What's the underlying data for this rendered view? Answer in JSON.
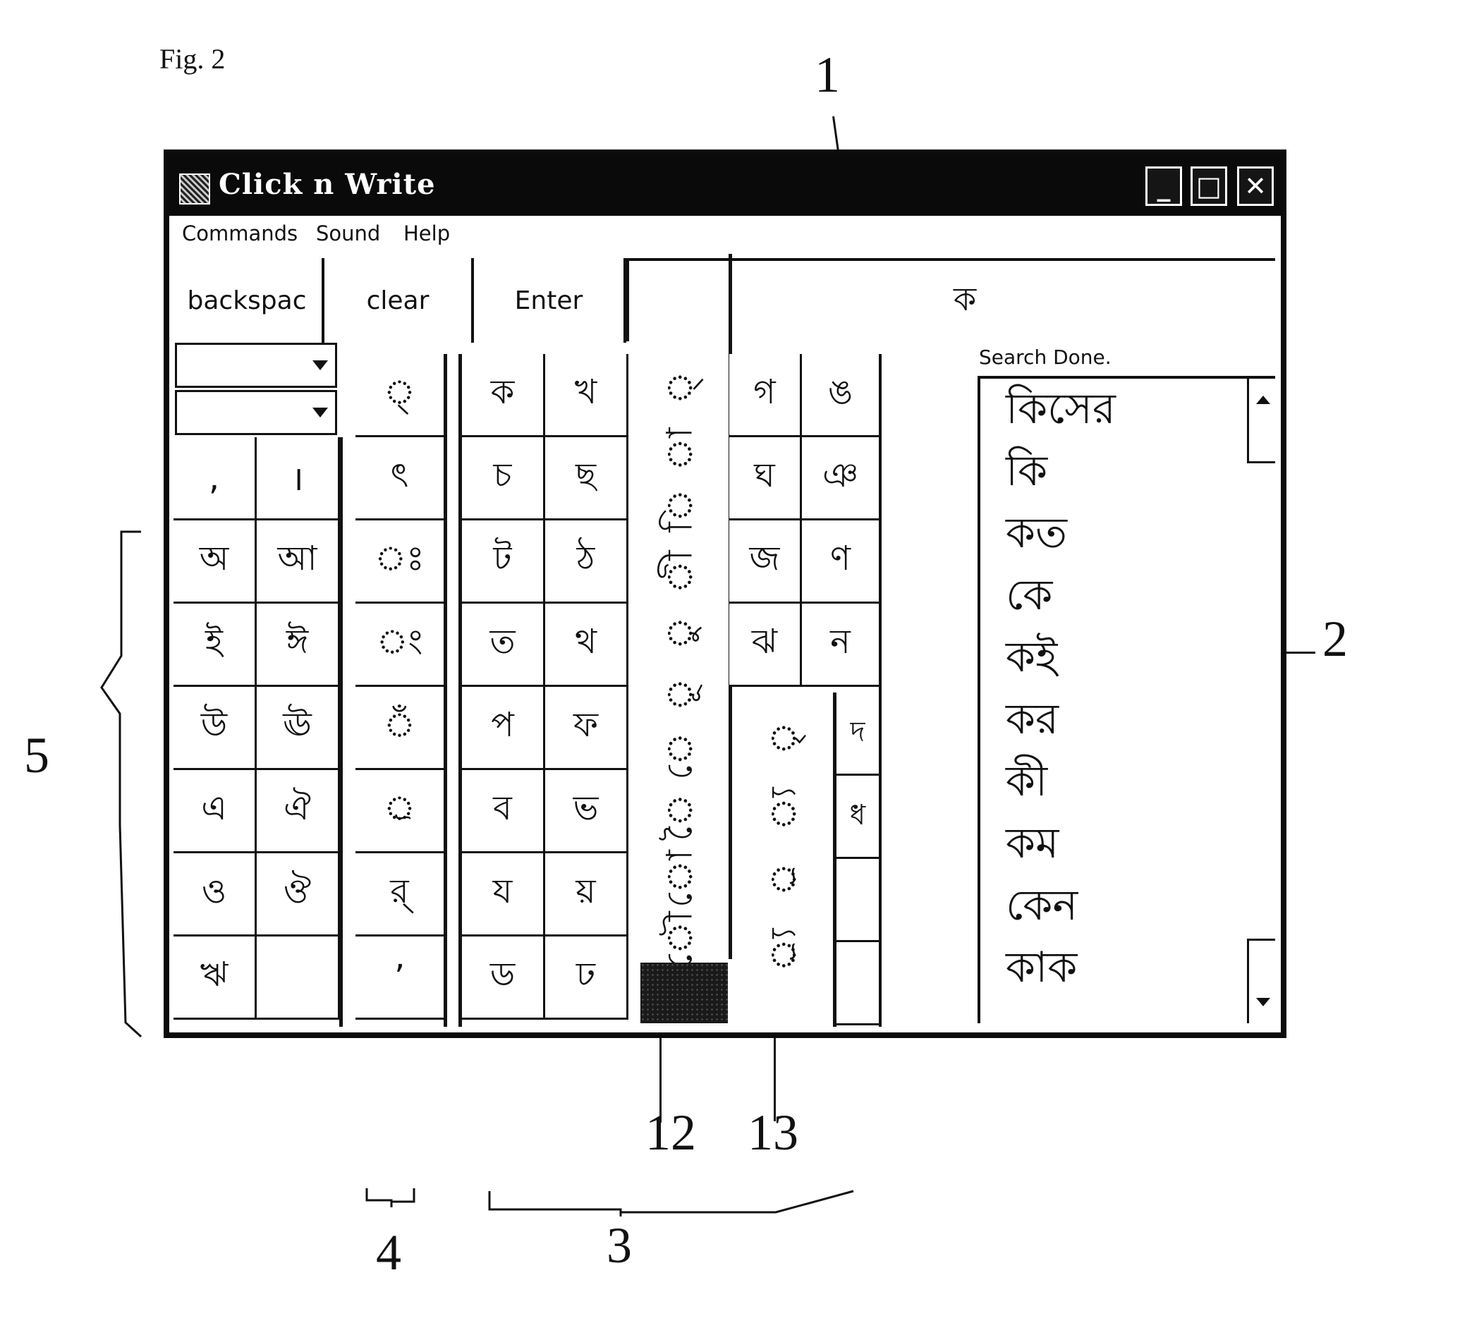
{
  "figure": {
    "label": "Fig. 2",
    "callouts": {
      "display": "1",
      "word_list": "2",
      "consonants": "3",
      "signs": "4",
      "vowels": "5",
      "vowel_signs": "12",
      "conjunct_signs": "13"
    }
  },
  "window": {
    "title": "Click n Write",
    "controls": {
      "minimize": "_",
      "maximize": "□",
      "close": "✕"
    }
  },
  "menu": [
    "Commands",
    "Sound",
    "Help"
  ],
  "toolbar": {
    "backspace": "backspac",
    "clear": "clear",
    "enter": "Enter"
  },
  "display": {
    "text": "ক"
  },
  "dropdowns": [
    {
      "value": ""
    },
    {
      "value": ""
    }
  ],
  "punctuation": [
    ",",
    "।"
  ],
  "vowels": [
    [
      "অ",
      "আ"
    ],
    [
      "ই",
      "ঈ"
    ],
    [
      "উ",
      "ঊ"
    ],
    [
      "এ",
      "ঐ"
    ],
    [
      "ও",
      "ঔ"
    ],
    [
      "ঋ",
      ""
    ]
  ],
  "signs": [
    "◌্",
    "ৎ",
    "◌ঃ",
    "◌ং",
    "◌ঁ",
    "্র",
    "র্",
    "ʼ"
  ],
  "consonants": [
    [
      "ক",
      "খ"
    ],
    [
      "চ",
      "ছ"
    ],
    [
      "ট",
      "ঠ"
    ],
    [
      "ত",
      "থ"
    ],
    [
      "প",
      "ফ"
    ],
    [
      "ব",
      "ভ"
    ],
    [
      "য",
      "য়"
    ],
    [
      "ড",
      "ঢ"
    ]
  ],
  "vowel_signs": [
    "◌্",
    "◌া",
    "◌ি",
    "◌ী",
    "◌ু",
    "◌ূ",
    "◌ে",
    "◌ৈ",
    "◌ো",
    "◌ৌ"
  ],
  "consonants_right": [
    [
      "গ",
      "ঙ"
    ],
    [
      "ঘ",
      "ঞ"
    ],
    [
      "জ",
      "ণ"
    ],
    [
      "ঝ",
      "ন"
    ]
  ],
  "conjunct_signs": [
    "◌ৃ",
    "◌্য",
    "◌্র",
    "◌্র্য"
  ],
  "consonants_right_lower": [
    "দ",
    "ধ",
    "",
    ""
  ],
  "search": {
    "status": "Search Done.",
    "results": [
      "কিসের",
      "কি",
      "কত",
      "কে",
      "কই",
      "কর",
      "কী",
      "কম",
      "কেন",
      "কাক"
    ]
  }
}
